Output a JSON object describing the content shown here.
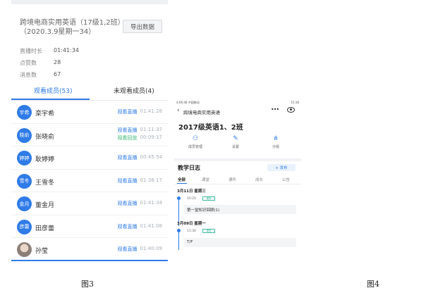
{
  "figure3": {
    "course_title": "跨境电商实用英语（17级1,2班）（2020.3.9星期一34）",
    "export_label": "导出数据",
    "stats": [
      {
        "label": "直播时长",
        "value": "01:41:34"
      },
      {
        "label": "点赞数",
        "value": "28"
      },
      {
        "label": "消息数",
        "value": "67"
      }
    ],
    "tabs": {
      "watched": "观看成员(53)",
      "not_watched": "未观看成员(4)"
    },
    "members": [
      {
        "avatar": "宇希",
        "name": "栾宇希",
        "lines": [
          {
            "kind": "观看直播",
            "time": "01:41:28",
            "color": "blue"
          }
        ]
      },
      {
        "avatar": "晓俞",
        "name": "张晓俞",
        "lines": [
          {
            "kind": "观看直播",
            "time": "01:11:37",
            "color": "blue"
          },
          {
            "kind": "观看回放",
            "time": "00:09:17",
            "color": "green"
          }
        ]
      },
      {
        "avatar": "婷婷",
        "name": "耿婷婷",
        "lines": [
          {
            "kind": "观看直播",
            "time": "00:45:54",
            "color": "blue"
          }
        ]
      },
      {
        "avatar": "雪冬",
        "name": "王雪冬",
        "lines": [
          {
            "kind": "观看直播",
            "time": "01:38:17",
            "color": "blue"
          }
        ]
      },
      {
        "avatar": "金月",
        "name": "董金月",
        "lines": [
          {
            "kind": "观看直播",
            "time": "01:41:34",
            "color": "blue"
          }
        ]
      },
      {
        "avatar": "彦蕾",
        "name": "田彦蕾",
        "lines": [
          {
            "kind": "观看直播",
            "time": "01:41:08",
            "color": "blue"
          }
        ]
      },
      {
        "avatar": "",
        "name": "孙莹",
        "lines": [
          {
            "kind": "观看直播",
            "time": "01:40:09",
            "color": "blue"
          }
        ]
      }
    ],
    "caption": "图3"
  },
  "figure4": {
    "status_left": "4:06:48 中国移动",
    "status_right": "15:38",
    "nav_title": "跨境电商实用英语",
    "nav_more": "•••",
    "class_name": "2017级英语1、2班",
    "shortcuts": [
      {
        "icon": "member-management-icon",
        "label": "成员管理"
      },
      {
        "icon": "settings-icon",
        "label": "设置"
      },
      {
        "icon": "group-icon",
        "label": "分组"
      }
    ],
    "journal_title": "教学日志",
    "publish_label": "+ 发布",
    "filter_tabs": [
      "全部",
      "课堂",
      "课件",
      "成长",
      "公告"
    ],
    "entries": [
      {
        "date": "3月11日  星期三",
        "time": "10:25",
        "tag": "课堂",
        "content": "第一堂知识回顾(1)"
      },
      {
        "date": "3月09日  星期一",
        "time": "11:30",
        "tag": "课堂",
        "content": "T/F"
      }
    ],
    "caption": "图4"
  },
  "colors": {
    "accent": "#2f7be8",
    "green": "#3cb878"
  }
}
